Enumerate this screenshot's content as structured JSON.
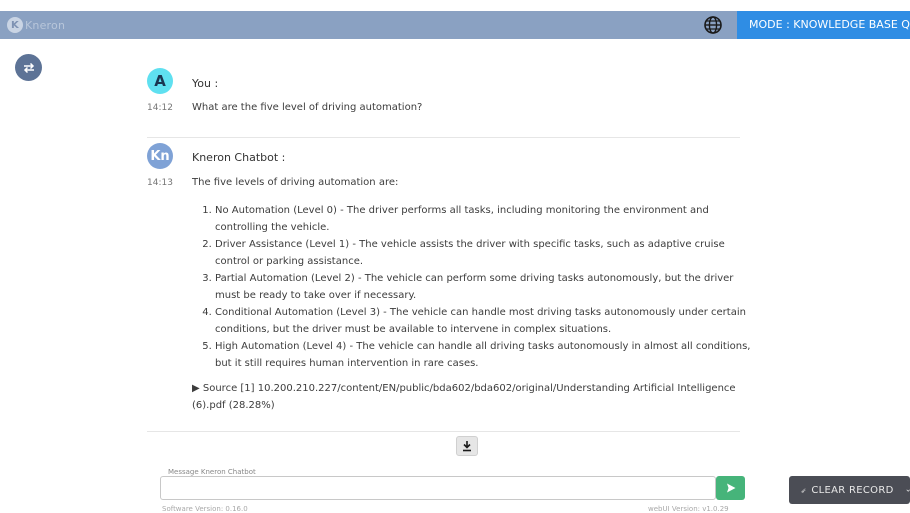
{
  "header": {
    "logo_text": "Kneron",
    "mode_label": "MODE : KNOWLEDGE BASE Q&A"
  },
  "conversation": {
    "user": {
      "avatar_letter": "A",
      "name": "You :",
      "time": "14:12",
      "message": "What are the five level of driving automation?"
    },
    "bot": {
      "avatar_text": "Kn",
      "name": "Kneron Chatbot :",
      "time": "14:13",
      "intro": "The five levels of driving automation are:",
      "levels": [
        "No Automation (Level 0) - The driver performs all tasks, including monitoring the environment and controlling the vehicle.",
        "Driver Assistance (Level 1) - The vehicle assists the driver with specific tasks, such as adaptive cruise control or parking assistance.",
        "Partial Automation (Level 2) - The vehicle can perform some driving tasks autonomously, but the driver must be ready to take over if necessary.",
        "Conditional Automation (Level 3) - The vehicle can handle most driving tasks autonomously under certain conditions, but the driver must be available to intervene in complex situations.",
        "High Automation (Level 4) - The vehicle can handle all driving tasks autonomously in almost all conditions, but it still requires human intervention in rare cases."
      ],
      "source": "▶ Source [1] 10.200.210.227/content/EN/public/bda602/bda602/original/Understanding Artificial Intelligence (6).pdf (28.28%)"
    }
  },
  "composer": {
    "label": "Message Kneron Chatbot",
    "value": "",
    "clear_label": "CLEAR RECORD"
  },
  "footer": {
    "software_version": "Software Version: 0.16.0",
    "webui_version": "webUI Version: v1.0.29"
  },
  "colors": {
    "header": "#8aa1c2",
    "mode_button": "#2f8de4",
    "send_button": "#46b47a",
    "clear_button": "#4b4d55"
  },
  "icons": [
    "globe-icon",
    "swap-icon",
    "download-icon",
    "send-icon",
    "broom-icon",
    "chevron-down-icon"
  ]
}
